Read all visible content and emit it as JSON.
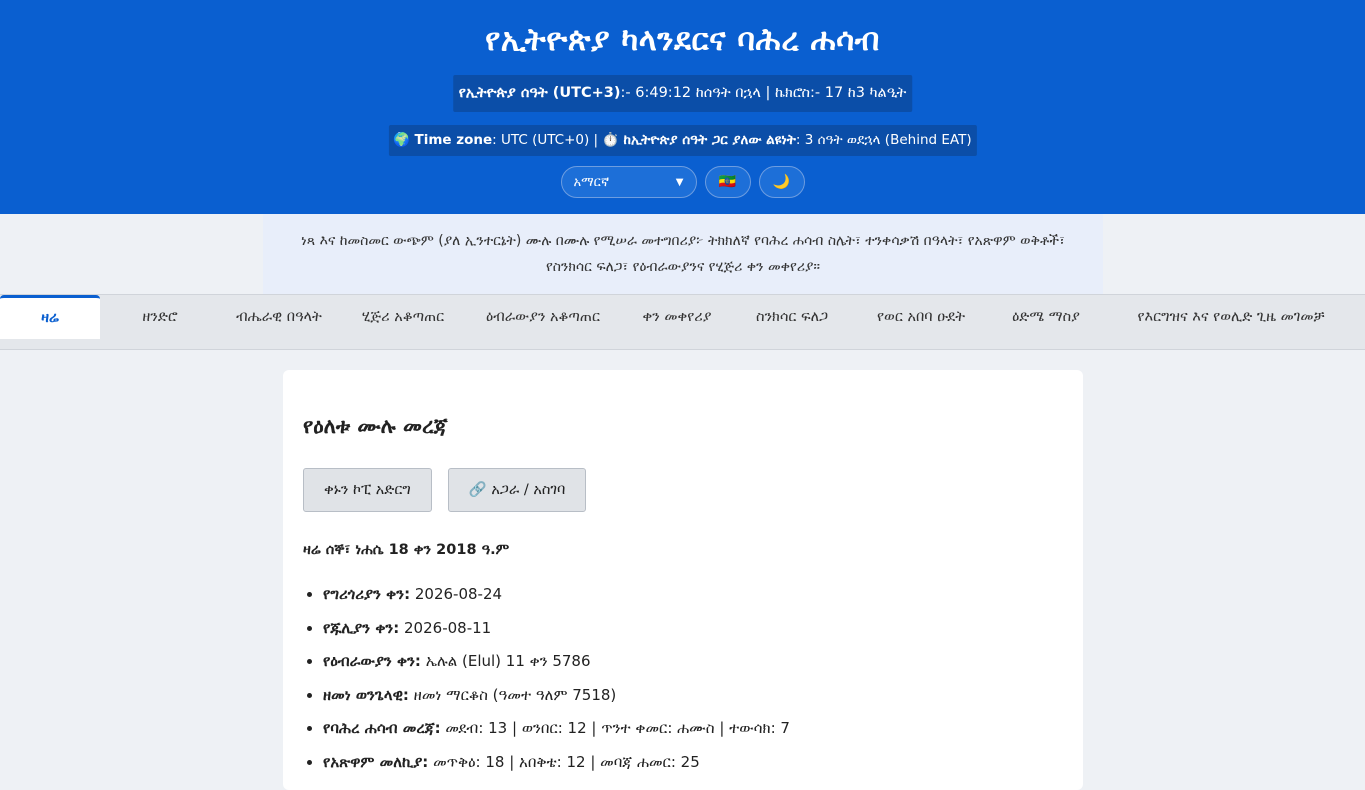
{
  "header": {
    "title": "የኢትዮጵያ ካላንደርና ባሕረ ሐሳብ",
    "clock_label": "የኢትዮጵያ ሰዓት (UTC+3)",
    "clock_value": ":- 6:49:12 ከሰዓት በኋላ | ኬክሮስ:- 17 ከ3 ካልዒት",
    "tz_icon": "🌍",
    "tz_label": "Time zone",
    "tz_value": ": UTC (UTC+0) |",
    "diff_icon": "⏱️",
    "diff_label": "ከኢትዮጵያ ሰዓት ጋር ያለው ልዩነት",
    "diff_value": ": 3 ሰዓት ወደኋላ (Behind EAT)",
    "language_selected": "አማርኛ",
    "flag_icon": "🇪🇹",
    "theme_icon": "🌙"
  },
  "description": "ነጻ እና ከመስመር ውጭም (ያለ ኢንተርኔት) ሙሉ በሙሉ የሚሠራ መተግበሪያ፦ ትክክለኛ የባሕረ ሐሳብ ስሌት፣ ተንቀሳቃሽ በዓላት፣ የአጽዋም ወቅቶች፣ የስንክሳር ፍለጋ፣ የዕብራውያንና የሂጅሪ ቀን መቀየሪያ።",
  "tabs": [
    "ዛሬ",
    "ዘንድሮ",
    "ብሔራዊ በዓላት",
    "ሂጅሪ አቆጣጠር",
    "ዕብራውያን አቆጣጠር",
    "ቀን መቀየሪያ",
    "ስንክሳር ፍለጋ",
    "የወር አበባ ዑደት",
    "ዕድሜ ማስያ",
    "የእርግዝና እና የወሊድ ጊዜ መገመቻ"
  ],
  "card": {
    "title": "የዕለቱ ሙሉ መረጃ",
    "copy_button": "ቀኑን ኮፒ አድርግ",
    "share_button": "🔗 አጋራ / አስገባ",
    "today": "ዛሬ ሰኞ፣ ነሐሴ 18 ቀን 2018 ዓ.ም",
    "facts": [
      {
        "label": "የግሪጎሪያን ቀን:",
        "value": " 2026-08-24"
      },
      {
        "label": "የጁሊያን ቀን:",
        "value": " 2026-08-11"
      },
      {
        "label": "የዕብራውያን ቀን:",
        "value": " ኤሉል (Elul) 11 ቀን 5786"
      },
      {
        "label": "ዘመነ ወንጌላዊ:",
        "value": " ዘመነ ማርቆስ (ዓመተ ዓለም 7518)"
      },
      {
        "label": "የባሕረ ሐሳብ መረጃ:",
        "value": " መደብ: 13 | ወንበር: 12 | ጥንተ ቀመር: ሐሙስ | ተውሳክ: 7"
      },
      {
        "label": "የአጽዋም መለኪያ:",
        "value": " መጥቅዕ: 18 | አበቅቴ: 12 | መባጃ ሐመር: 25"
      }
    ]
  }
}
